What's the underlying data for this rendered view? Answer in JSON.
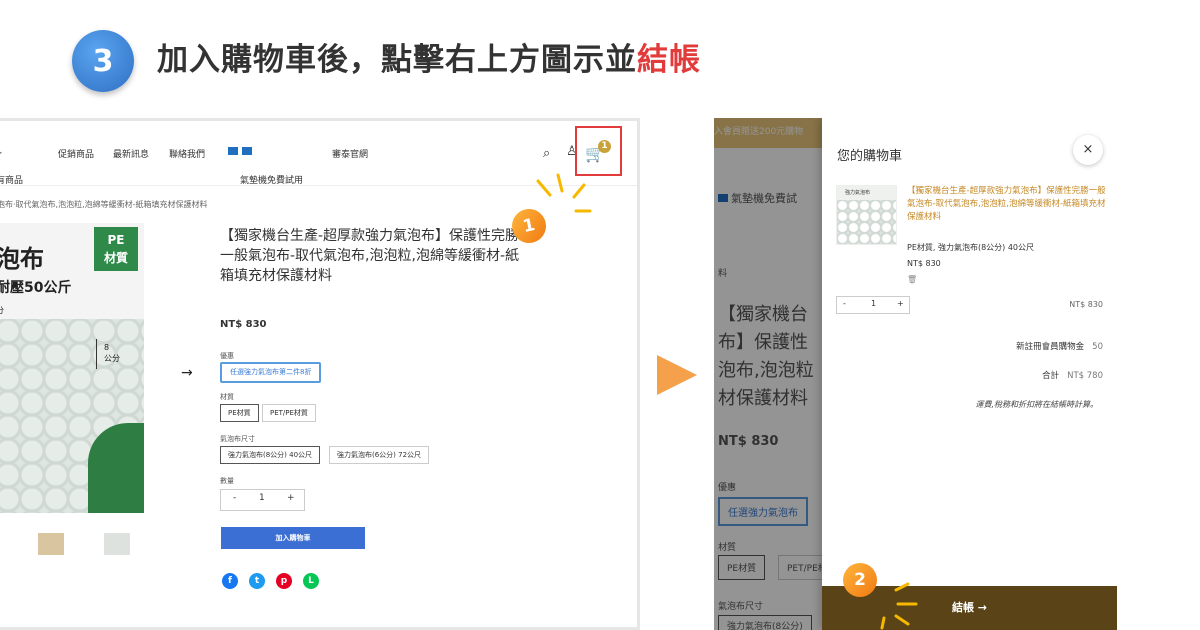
{
  "step": {
    "number": "3",
    "heading_main": "加入購物車後，點擊右上方圖示並",
    "heading_accent": "結帳",
    "accent_color": "#e23b3b"
  },
  "store_page": {
    "nav": {
      "items": [
        "有商品",
        "促銷商品",
        "最新訊息",
        "聯絡我們",
        "氣墊機免費試用",
        "審泰官網"
      ],
      "search_icon": "search-icon",
      "user_icon": "user-icon",
      "cart_icon": "cart-icon",
      "cart_count": "1"
    },
    "breadcrumb": "泡布·取代氣泡布,泡泡粒,泡綿等緩衝材-紙箱填充材保護材料",
    "image": {
      "title": "泡布",
      "subtitle": "耐壓50公斤",
      "badge_line1": "PE",
      "badge_line2": "材質",
      "label_small": "分",
      "size_num": "8",
      "size_unit": "公分"
    },
    "product": {
      "title": "【獨家機台生產-超厚款強力氣泡布】保護性完勝一般氣泡布-取代氣泡布,泡泡粒,泡綿等緩衝材-紙箱填充材保護材料",
      "price": "NT$ 830",
      "promo_label": "優惠",
      "promo_option": "任選強力氣泡布第二件8折",
      "material_label": "材質",
      "material_options": [
        "PE材質",
        "PET/PE材質"
      ],
      "size_label": "氣泡布尺寸",
      "size_options": [
        "強力氣泡布(8公分) 40公尺",
        "強力氣泡布(6公分) 72公尺"
      ],
      "qty_label": "數量",
      "qty_minus": "-",
      "qty_value": "1",
      "qty_plus": "+",
      "add_to_cart": "加入購物車"
    },
    "share_icons": [
      "facebook-icon",
      "twitter-icon",
      "pinterest-icon",
      "line-icon"
    ],
    "callout": "1"
  },
  "cart_drawer": {
    "background": {
      "banner": "入會員贈送200元購物",
      "nav_item": "氣墊機免費試",
      "crumb": "料",
      "title": "【獨家機台\n布】保護性\n泡布,泡泡粒\n材保護材料",
      "price": "NT$ 830",
      "promo_label": "優惠",
      "promo_option": "任選強力氣泡布",
      "material_label": "材質",
      "material_options": [
        "PE材質",
        "PET/PE材"
      ],
      "size_label": "氣泡布尺寸",
      "size_option": "強力氣泡布(8公分)"
    },
    "title": "您的購物車",
    "close": "×",
    "item": {
      "thumb_title": "強力氣泡布",
      "name": "【獨家機台生產-超厚款強力氣泡布】保護性完勝一般氣泡布-取代氣泡布,泡泡粒,泡綿等緩衝材-紙箱填充材保護材料",
      "variant": "PE材質, 強力氣泡布(8公分) 40公尺",
      "price": "NT$ 830",
      "qty_minus": "-",
      "qty": "1",
      "qty_plus": "+",
      "line_total": "NT$ 830"
    },
    "credit_label": "新註冊會員購物金",
    "credit_value": "50",
    "total_label": "合計",
    "total_value": "NT$ 780",
    "note": "運費,稅務和折扣將在結帳時計算。",
    "checkout": "結帳 →",
    "callout": "2"
  }
}
